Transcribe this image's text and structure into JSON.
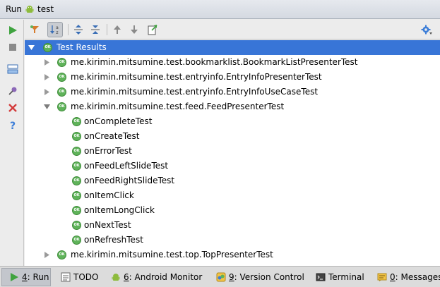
{
  "window": {
    "title_prefix": "Run",
    "title_config": "test"
  },
  "left_toolbar": {
    "items": [
      {
        "icon": "rerun-icon"
      },
      {
        "icon": "stop-icon"
      },
      {
        "icon": "layout-icon"
      },
      {
        "icon": "pin-icon"
      },
      {
        "icon": "close-icon"
      },
      {
        "icon": "help-icon"
      }
    ]
  },
  "toolbar": {
    "items": [
      {
        "icon": "filter-passed-icon"
      },
      {
        "icon": "sort-alpha-icon",
        "pressed": true
      },
      {
        "icon": "expand-all-icon"
      },
      {
        "icon": "collapse-all-icon"
      },
      {
        "icon": "prev-failed-icon"
      },
      {
        "icon": "next-failed-icon"
      },
      {
        "icon": "export-icon"
      },
      {
        "icon": "settings-icon"
      }
    ]
  },
  "tree": {
    "status_icon_text": "OK",
    "root_label": "Test Results",
    "items": [
      {
        "label": "me.kirimin.mitsumine.test.bookmarklist.BookmarkListPresenterTest",
        "level": 1,
        "expanded": false
      },
      {
        "label": "me.kirimin.mitsumine.test.entryinfo.EntryInfoPresenterTest",
        "level": 1,
        "expanded": false
      },
      {
        "label": "me.kirimin.mitsumine.test.entryinfo.EntryInfoUseCaseTest",
        "level": 1,
        "expanded": false
      },
      {
        "label": "me.kirimin.mitsumine.test.feed.FeedPresenterTest",
        "level": 1,
        "expanded": true
      },
      {
        "label": "onCompleteTest",
        "level": 2
      },
      {
        "label": "onCreateTest",
        "level": 2
      },
      {
        "label": "onErrorTest",
        "level": 2
      },
      {
        "label": "onFeedLeftSlideTest",
        "level": 2
      },
      {
        "label": "onFeedRightSlideTest",
        "level": 2
      },
      {
        "label": "onItemClick",
        "level": 2
      },
      {
        "label": "onItemLongClick",
        "level": 2
      },
      {
        "label": "onNextTest",
        "level": 2
      },
      {
        "label": "onRefreshTest",
        "level": 2
      },
      {
        "label": "me.kirimin.mitsumine.test.top.TopPresenterTest",
        "level": 1,
        "expanded": false
      }
    ]
  },
  "status_bar": {
    "tabs": [
      {
        "mnemonic": "4",
        "rest": ": Run",
        "icon": "run-icon",
        "active": true
      },
      {
        "mnemonic": "",
        "rest": "TODO",
        "icon": "todo-icon",
        "active": false
      },
      {
        "mnemonic": "6",
        "rest": ": Android Monitor",
        "icon": "android-icon",
        "active": false
      },
      {
        "mnemonic": "9",
        "rest": ": Version Control",
        "icon": "vcs-icon",
        "active": false
      },
      {
        "mnemonic": "",
        "rest": "Terminal",
        "icon": "terminal-icon",
        "active": false
      },
      {
        "mnemonic": "0",
        "rest": ": Messages",
        "icon": "messages-icon",
        "active": false
      }
    ]
  },
  "colors": {
    "selection": "#3875d7",
    "ok_green": "#5fb35a",
    "run_green": "#3fa33f",
    "stop_gray": "#8a8a8a",
    "error_red": "#d33c3c",
    "help_blue": "#3b7dd8"
  }
}
